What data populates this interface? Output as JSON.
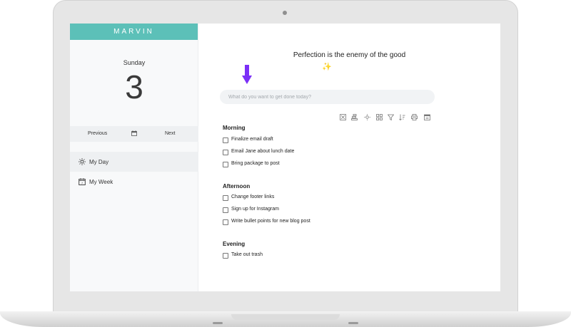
{
  "app": {
    "logo": "MARVIN"
  },
  "date": {
    "weekday": "Sunday",
    "day_number": "3"
  },
  "date_nav": {
    "previous_label": "Previous",
    "next_label": "Next"
  },
  "sidebar": {
    "items": [
      {
        "label": "My Day",
        "icon": "sun-icon",
        "active": true
      },
      {
        "label": "My Week",
        "icon": "calendar-icon",
        "active": false
      }
    ]
  },
  "header": {
    "quote": "Perfection is the enemy of the good",
    "quote_emoji": "✨"
  },
  "task_input": {
    "placeholder": "What do you want to get done today?"
  },
  "toolbar": {
    "icons": [
      "expand-icon",
      "stack-icon",
      "sun-icon",
      "grid-icon",
      "filter-icon",
      "sort-icon",
      "print-icon",
      "calendar-icon"
    ]
  },
  "sections": [
    {
      "title": "Morning",
      "tasks": [
        "Finalize email draft",
        "Email Jane about lunch date",
        "Bring package to post"
      ]
    },
    {
      "title": "Afternoon",
      "tasks": [
        "Change footer links",
        "Sign up for Instagram",
        "Write bullet points for new blog post"
      ]
    },
    {
      "title": "Evening",
      "tasks": [
        "Take out trash"
      ]
    }
  ],
  "colors": {
    "brand": "#5cc0b8",
    "arrow": "#7b2ff7",
    "sparkle": "#e7c94a"
  }
}
